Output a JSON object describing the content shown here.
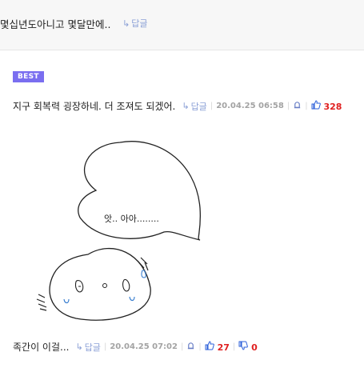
{
  "top_comment": {
    "text": "몇십년도아니고 몇달만에..",
    "reply_label": "답글"
  },
  "best_comment": {
    "badge": "BEST",
    "text": "지구 회복력 굉장하네. 더 조져도 되겠어.",
    "reply_label": "답글",
    "date": "20.04.25 06:58",
    "likes": "328"
  },
  "drawing": {
    "bubble_text": "앗.. 아아........"
  },
  "bottom_comment": {
    "text": "족간이 이걸...",
    "reply_label": "답글",
    "date": "20.04.25 07:02",
    "likes": "27",
    "dislikes": "0"
  },
  "icons": {
    "reply": "reply-arrow-icon",
    "report": "bell-icon",
    "like": "thumbs-up-icon",
    "dislike": "thumbs-down-icon"
  },
  "colors": {
    "accent": "#7a6ef0",
    "count": "#e02020",
    "link": "#8a9fd6"
  }
}
